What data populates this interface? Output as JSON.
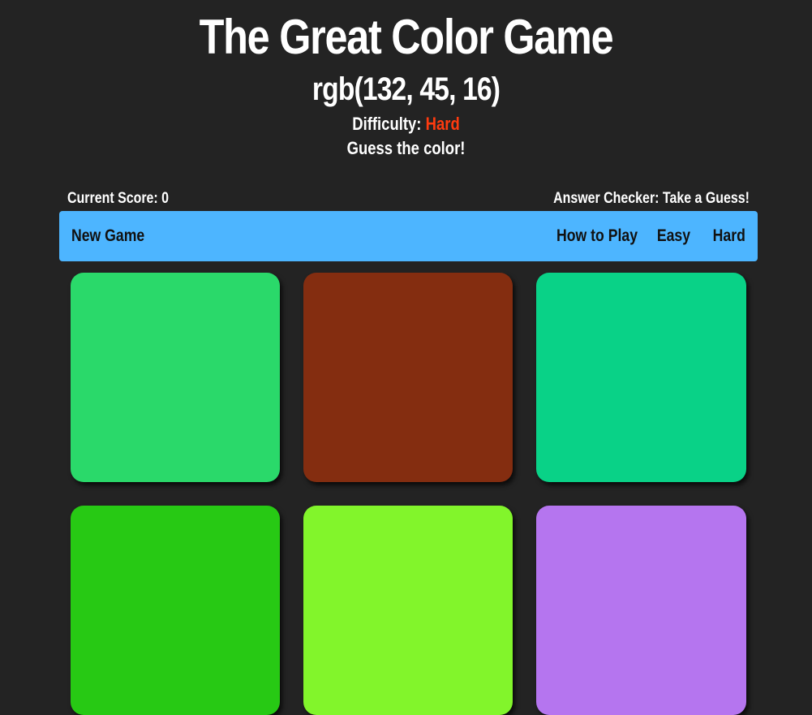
{
  "header": {
    "title": "The Great Color Game",
    "target_color": "rgb(132, 45, 16)",
    "difficulty_label": "Difficulty:",
    "difficulty_value": "Hard",
    "message": "Guess the color!"
  },
  "status": {
    "score": "Current Score: 0",
    "answer_checker": "Answer Checker: Take a Guess!"
  },
  "navbar": {
    "new_game": "New Game",
    "how_to_play": "How to Play",
    "easy": "Easy",
    "hard": "Hard"
  },
  "colors": {
    "background": "#232323",
    "navbar": "#4db5ff",
    "difficulty_accent": "#ff3b0f"
  },
  "squares": [
    "#2ad96a",
    "#842d10",
    "#09d287",
    "#27c914",
    "#82f52b",
    "#b575ef"
  ]
}
